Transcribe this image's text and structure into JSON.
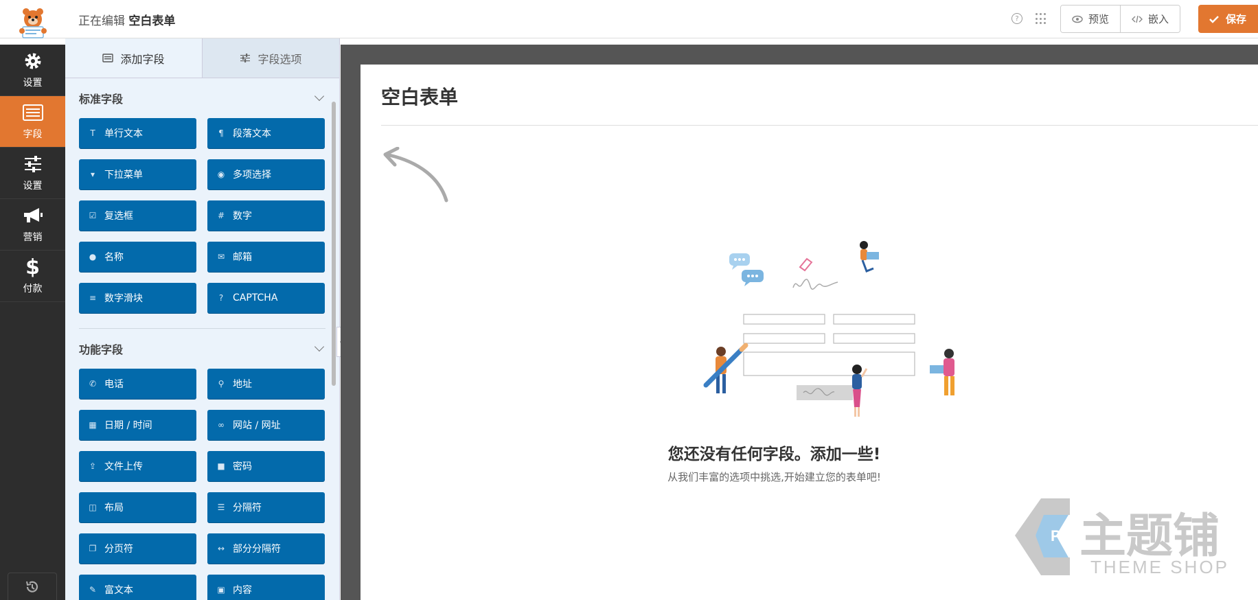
{
  "header": {
    "editing_label": "正在编辑",
    "form_name": "空白表单",
    "preview_label": "预览",
    "embed_label": "嵌入",
    "save_label": "保存"
  },
  "leftnav": {
    "items": [
      {
        "label": "设置",
        "icon": "gear-icon"
      },
      {
        "label": "字段",
        "icon": "fields-list-icon",
        "active": true
      },
      {
        "label": "设置",
        "icon": "sliders-icon"
      },
      {
        "label": "营销",
        "icon": "megaphone-icon"
      },
      {
        "label": "付款",
        "icon": "dollar-icon"
      }
    ],
    "revisions_icon": "history-icon"
  },
  "panel": {
    "tabs": [
      {
        "label": "添加字段",
        "active": true
      },
      {
        "label": "字段选项",
        "active": false
      }
    ],
    "sections": [
      {
        "title": "标准字段",
        "fields": [
          {
            "label": "单行文本",
            "icon": "text-icon"
          },
          {
            "label": "段落文本",
            "icon": "paragraph-icon"
          },
          {
            "label": "下拉菜单",
            "icon": "dropdown-icon"
          },
          {
            "label": "多项选择",
            "icon": "radio-icon"
          },
          {
            "label": "复选框",
            "icon": "checkbox-icon"
          },
          {
            "label": "数字",
            "icon": "hash-icon"
          },
          {
            "label": "名称",
            "icon": "user-icon"
          },
          {
            "label": "邮箱",
            "icon": "envelope-icon"
          },
          {
            "label": "数字滑块",
            "icon": "slider-icon"
          },
          {
            "label": "CAPTCHA",
            "icon": "question-circle-icon"
          }
        ]
      },
      {
        "title": "功能字段",
        "fields": [
          {
            "label": "电话",
            "icon": "phone-icon"
          },
          {
            "label": "地址",
            "icon": "map-pin-icon"
          },
          {
            "label": "日期 / 时间",
            "icon": "calendar-icon"
          },
          {
            "label": "网站 / 网址",
            "icon": "link-icon"
          },
          {
            "label": "文件上传",
            "icon": "upload-icon"
          },
          {
            "label": "密码",
            "icon": "lock-icon"
          },
          {
            "label": "布局",
            "icon": "columns-icon"
          },
          {
            "label": "分隔符",
            "icon": "divider-icon"
          },
          {
            "label": "分页符",
            "icon": "copy-icon"
          },
          {
            "label": "部分分隔符",
            "icon": "arrows-h-icon"
          },
          {
            "label": "富文本",
            "icon": "edit-icon"
          },
          {
            "label": "内容",
            "icon": "image-icon"
          }
        ]
      }
    ]
  },
  "preview": {
    "title": "空白表单",
    "empty_title": "您还没有任何字段。添加一些!",
    "empty_subtitle": "从我们丰富的选项中挑选,开始建立您的表单吧!"
  },
  "watermark": {
    "main": "主题铺",
    "sub": "THEME SHOP"
  },
  "colors": {
    "accent": "#e27730",
    "field_button": "#036aab",
    "sidebar": "#2d2d2d",
    "panel_bg": "#ebf3fb"
  }
}
